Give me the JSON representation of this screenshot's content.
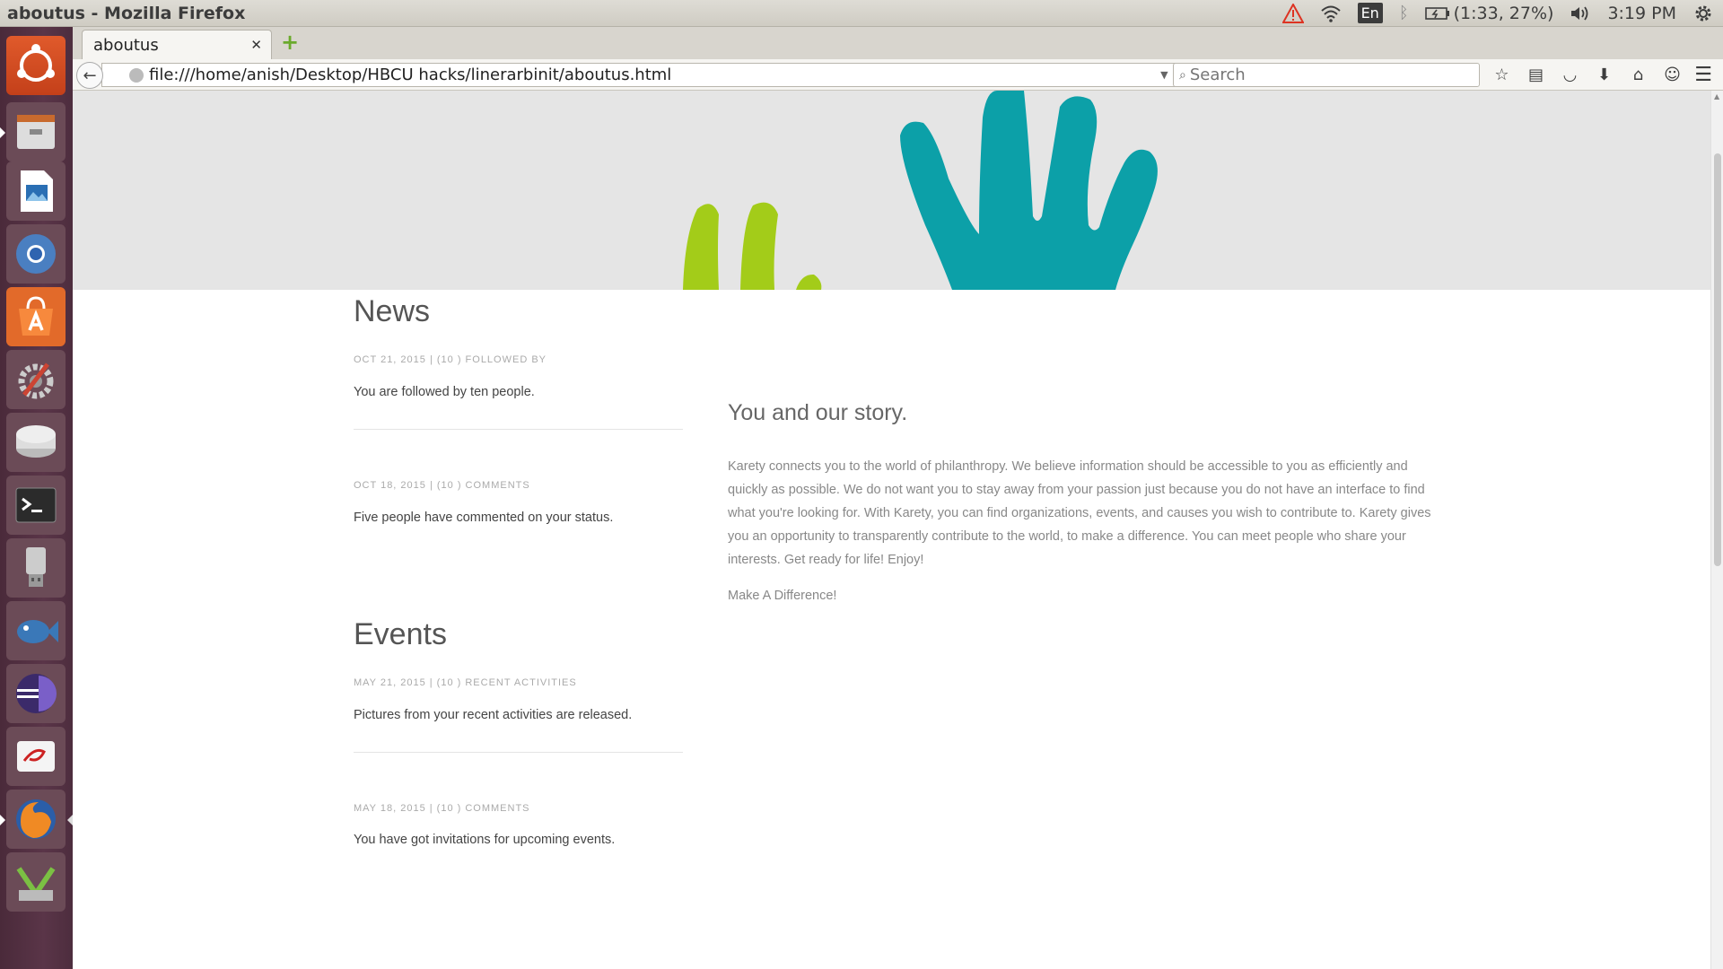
{
  "window": {
    "title": "aboutus - Mozilla Firefox"
  },
  "indicators": {
    "lang": "En",
    "battery": "(1:33, 27%)",
    "clock": "3:19 PM"
  },
  "browser": {
    "tab_title": "aboutus",
    "url": "file:///home/anish/Desktop/HBCU hacks/linerarbinit/aboutus.html",
    "search_placeholder": "Search"
  },
  "hero": {
    "colors": {
      "background": "#e5e5e5",
      "green": "#a3cc19",
      "teal": "#0ca0a8"
    }
  },
  "news": {
    "title": "News",
    "posts": [
      {
        "meta": "OCT 21, 2015 | (10 ) FOLLOWED BY",
        "text": "You are followed by ten people."
      },
      {
        "meta": "OCT 18, 2015 | (10 ) COMMENTS",
        "text": "Five people have commented on your status."
      }
    ]
  },
  "events": {
    "title": "Events",
    "posts": [
      {
        "meta": "MAY 21, 2015 | (10 ) RECENT ACTIVITIES",
        "text": "Pictures from your recent activities are released."
      },
      {
        "meta": "MAY 18, 2015 | (10 ) COMMENTS",
        "text": "You have got invitations for upcoming events."
      }
    ]
  },
  "story": {
    "title": "You and our story.",
    "body": "Karety connects you to the world of philanthropy. We believe information should be accessible to you as efficiently and quickly as possible. We do not want you to stay away from your passion just because you do not have an interface to find what you're looking for. With Karety, you can find organizations, events, and causes you wish to contribute to. Karety gives you an opportunity to transparently contribute to the world, to make a difference. You can meet people who share your interests. Get ready for life! Enjoy!",
    "cta": "Make A Difference!"
  },
  "launcher": {
    "items": [
      "ubuntu-dash-icon",
      "files-icon",
      "libreoffice-impress-icon",
      "chromium-icon",
      "software-center-icon",
      "system-settings-icon",
      "disk-icon",
      "terminal-icon",
      "usb-icon",
      "bluefish-icon",
      "eclipse-icon",
      "evince-icon",
      "firefox-icon",
      "manager-icon"
    ]
  }
}
